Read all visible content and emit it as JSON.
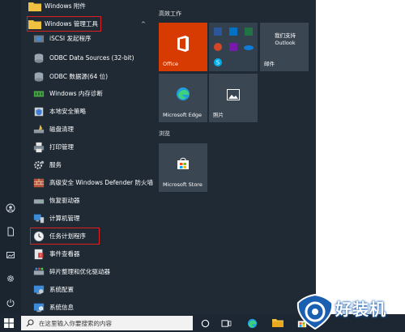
{
  "app_list": {
    "top_folder": "Windows 附件",
    "admin_folder": "Windows 管理工具",
    "items": [
      "iSCSI 发起程序",
      "ODBC Data Sources (32-bit)",
      "ODBC 数据源(64 位)",
      "Windows 内存诊断",
      "本地安全策略",
      "磁盘清理",
      "打印管理",
      "服务",
      "高级安全 Windows Defender 防火墙",
      "恢复驱动器",
      "计算机管理",
      "任务计划程序",
      "事件查看器",
      "碎片整理和优化驱动器",
      "系统配置",
      "系统信息"
    ],
    "collapse_glyph": "^"
  },
  "tiles": {
    "group1_title": "高效工作",
    "office_label": "Office",
    "outlook_text": "我们支持 Outlook",
    "mail_label": "邮件",
    "edge_label": "Microsoft Edge",
    "photos_label": "照片",
    "group2_title": "浏览",
    "store_label": "Microsoft Store"
  },
  "taskbar": {
    "search_placeholder": "在这里输入你要搜索的内容"
  },
  "watermark": {
    "text": "好装机"
  },
  "colors": {
    "start_bg": "#1f2a35",
    "office": "#d83b01",
    "highlight": "#e02020"
  }
}
